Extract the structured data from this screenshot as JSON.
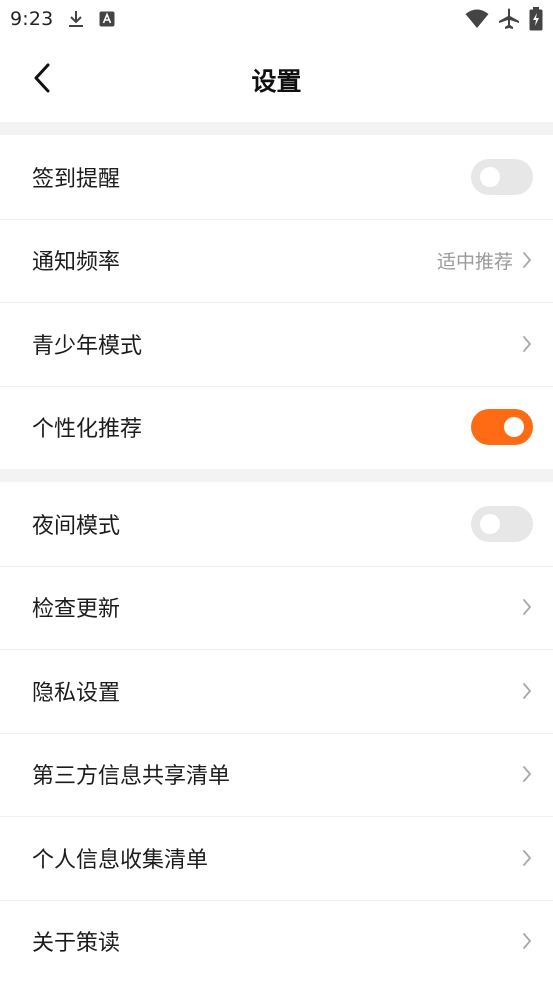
{
  "status_bar": {
    "time": "9:23",
    "icons": [
      "download-icon",
      "keyboard-a-icon",
      "wifi-icon",
      "airplane-mode-icon",
      "battery-charging-icon"
    ]
  },
  "header": {
    "title": "设置",
    "back_icon": "back-arrow-icon"
  },
  "groups": [
    {
      "rows": [
        {
          "label": "签到提醒",
          "type": "toggle",
          "checked": false
        },
        {
          "label": "通知频率",
          "type": "link",
          "value": "适中推荐"
        },
        {
          "label": "青少年模式",
          "type": "link"
        },
        {
          "label": "个性化推荐",
          "type": "toggle",
          "checked": true
        }
      ]
    },
    {
      "rows": [
        {
          "label": "夜间模式",
          "type": "toggle",
          "checked": false
        },
        {
          "label": "检查更新",
          "type": "link"
        },
        {
          "label": "隐私设置",
          "type": "link"
        },
        {
          "label": "第三方信息共享清单",
          "type": "link"
        },
        {
          "label": "个人信息收集清单",
          "type": "link"
        },
        {
          "label": "关于策读",
          "type": "link"
        }
      ]
    }
  ],
  "colors": {
    "accent": "#ff6a14",
    "toggle_off": "#e7e7e7",
    "section_gap": "#f3f3f3",
    "secondary_text": "#9a9a9a",
    "chevron": "#a8a8a8"
  }
}
